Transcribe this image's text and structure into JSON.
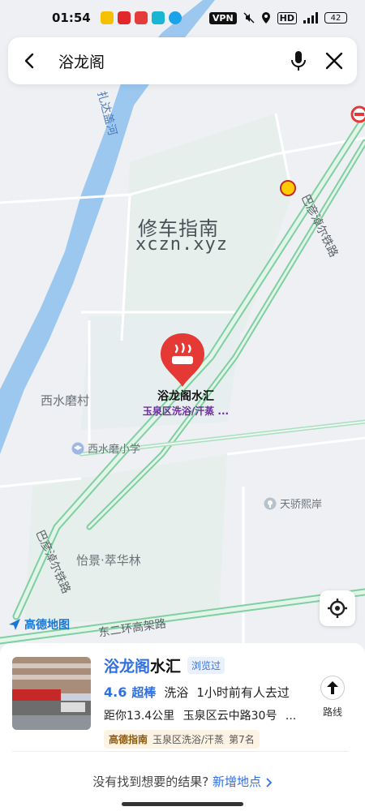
{
  "status_bar": {
    "time": "01:54",
    "vpn": "VPN",
    "hd": "HD",
    "battery": "42",
    "app_colors": [
      "#f5c000",
      "#e3262c",
      "#e63b3b",
      "#19b6d4",
      "#1aa3e8"
    ]
  },
  "search": {
    "query": "浴龙阁"
  },
  "map": {
    "watermark_line1": "修车指南",
    "watermark_line2": "xczn.xyz",
    "river_label": "扎达盖河",
    "road_label_right": "巴彦淖尔铁路",
    "road_label_left": "巴彦淖尔铁路",
    "road_label_bottom": "东二环高架路",
    "area_label_xishuimo": "西水磨村",
    "poi_school": "西水磨小学",
    "poi_tianjiao": "天骄熙岸",
    "poi_yijing": "怡景·萃华林",
    "marker_title": "浴龙阁水汇",
    "marker_subtitle": "玉泉区洗浴/汗蒸 ...",
    "logo_text": "高德地图",
    "colors": {
      "river": "#9cc8f0",
      "marker": "#e53935",
      "road_green": "#a9dfbf"
    }
  },
  "result": {
    "name_highlight": "浴龙阁",
    "name_rest": "水汇",
    "viewed_tag": "浏览过",
    "rating": "4.6",
    "rating_label": "超棒",
    "category": "洗浴",
    "recent": "1小时前有人去过",
    "distance": "距你13.4公里",
    "address": "玉泉区云中路30号",
    "ellipsis": "...",
    "guide_brand": "高德指南",
    "guide_text": "玉泉区洗浴/汗蒸",
    "guide_rank": "第7名",
    "route_label": "路线"
  },
  "footer": {
    "prompt": "没有找到想要的结果?",
    "add_link": "新增地点"
  }
}
